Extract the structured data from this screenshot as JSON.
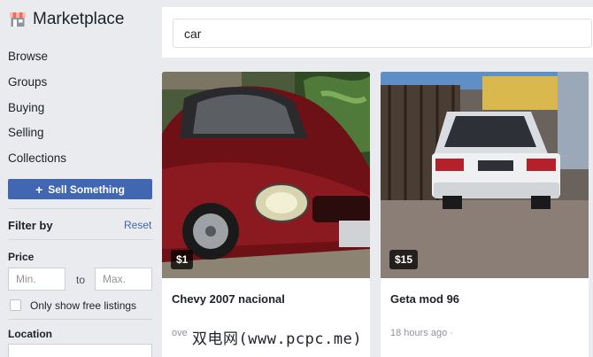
{
  "app": {
    "title": "Marketplace",
    "icon": "storefront-icon",
    "accent": "#4267b2"
  },
  "sidebar": {
    "items": [
      {
        "label": "Browse"
      },
      {
        "label": "Groups"
      },
      {
        "label": "Buying"
      },
      {
        "label": "Selling"
      },
      {
        "label": "Collections"
      }
    ],
    "sell_button": {
      "icon": "plus-icon",
      "label": "Sell Something"
    }
  },
  "filters": {
    "title": "Filter by",
    "reset": "Reset",
    "price": {
      "label": "Price",
      "min_placeholder": "Min.",
      "max_placeholder": "Max.",
      "separator": "to"
    },
    "free_only": {
      "label": "Only show free listings",
      "checked": false
    },
    "location": {
      "label": "Location"
    }
  },
  "search": {
    "value": "car"
  },
  "listings": [
    {
      "price": "$1",
      "title": "Chevy 2007 nacional",
      "meta": "ove"
    },
    {
      "price": "$15",
      "title": "Geta mod 96",
      "meta": "18 hours ago ·"
    }
  ],
  "watermark": "双电网(www.pcpc.me)"
}
